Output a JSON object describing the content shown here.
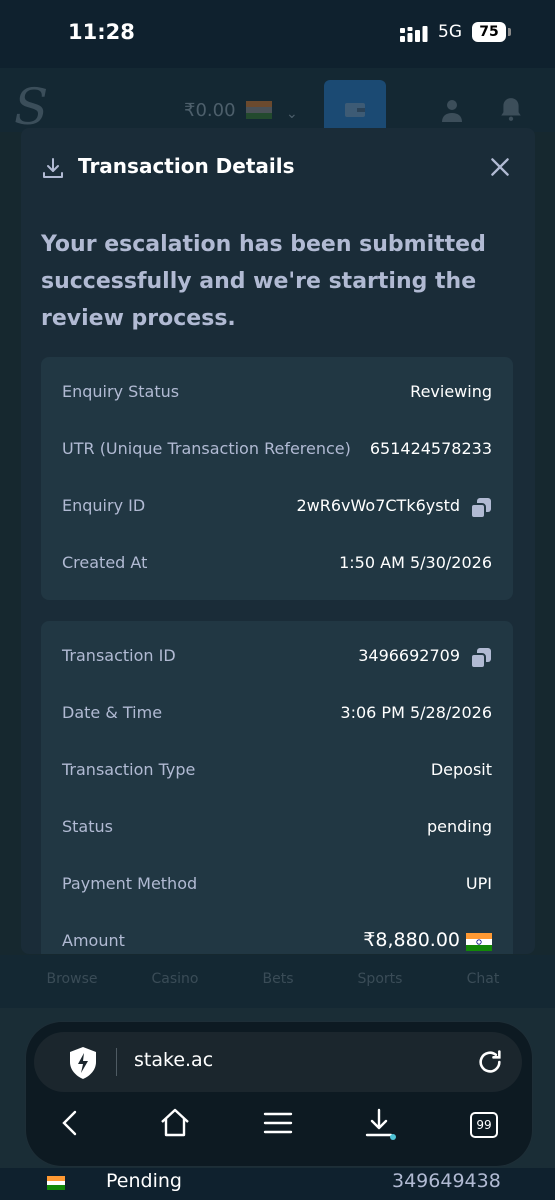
{
  "status_bar": {
    "time": "11:28",
    "network": "5G",
    "battery": "75"
  },
  "background_app": {
    "balance": "₹0.00",
    "nav": [
      "Browse",
      "Casino",
      "Bets",
      "Sports",
      "Chat"
    ]
  },
  "modal": {
    "title": "Transaction Details",
    "message": "Your escalation has been submitted successfully and we're starting the review process.",
    "enquiry_rows": [
      {
        "label": "Enquiry Status",
        "value": "Reviewing"
      },
      {
        "label": "UTR (Unique Transaction Reference)",
        "value": "651424578233"
      },
      {
        "label": "Enquiry ID",
        "value": "2wR6vWo7CTk6ystd"
      },
      {
        "label": "Created At",
        "value": "1:50 AM 5/30/2026"
      }
    ],
    "transaction_rows": [
      {
        "label": "Transaction ID",
        "value": "3496692709"
      },
      {
        "label": "Date & Time",
        "value": "3:06 PM 5/28/2026"
      },
      {
        "label": "Transaction Type",
        "value": "Deposit"
      },
      {
        "label": "Status",
        "value": "pending"
      },
      {
        "label": "Payment Method",
        "value": "UPI"
      },
      {
        "label": "Amount",
        "value": "₹8,880.00"
      }
    ]
  },
  "browser": {
    "url": "stake.ac",
    "tab_count": "99"
  },
  "peek_row": {
    "status": "Pending",
    "id": "349649438"
  },
  "colors": {
    "background": "#0f212e",
    "modal": "#1a2c38",
    "card": "#213743",
    "label": "#b1bad3"
  }
}
